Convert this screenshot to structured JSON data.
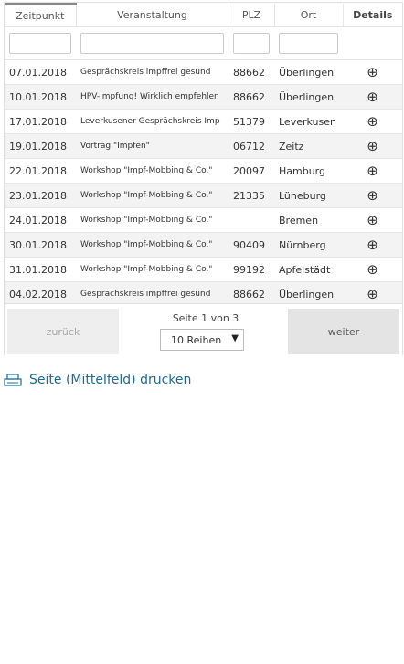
{
  "table": {
    "headers": [
      "Zeitpunkt",
      "Veranstaltung",
      "PLZ",
      "Ort",
      "Details"
    ],
    "rows": [
      {
        "date": "07.01.2018",
        "event": "Gesprächskreis impffrei gesund",
        "plz": "88662",
        "ort": "Überlingen"
      },
      {
        "date": "10.01.2018",
        "event": "HPV-Impfung! Wirklich empfehlen",
        "plz": "88662",
        "ort": "Überlingen"
      },
      {
        "date": "17.01.2018",
        "event": "Leverkusener Gesprächskreis Imp",
        "plz": "51379",
        "ort": "Leverkusen"
      },
      {
        "date": "19.01.2018",
        "event": "Vortrag \"Impfen\"",
        "plz": "06712",
        "ort": "Zeitz"
      },
      {
        "date": "22.01.2018",
        "event": "Workshop \"Impf-Mobbing & Co.\"",
        "plz": "20097",
        "ort": "Hamburg"
      },
      {
        "date": "23.01.2018",
        "event": "Workshop \"Impf-Mobbing & Co.\"",
        "plz": "21335",
        "ort": "Lüneburg"
      },
      {
        "date": "24.01.2018",
        "event": "Workshop \"Impf-Mobbing & Co.\"",
        "plz": "",
        "ort": "Bremen"
      },
      {
        "date": "30.01.2018",
        "event": "Workshop \"Impf-Mobbing & Co.\"",
        "plz": "90409",
        "ort": "Nürnberg"
      },
      {
        "date": "31.01.2018",
        "event": "Workshop \"Impf-Mobbing & Co.\"",
        "plz": "99192",
        "ort": "Apfelstädt"
      },
      {
        "date": "04.02.2018",
        "event": "Gesprächskreis impffrei gesund",
        "plz": "88662",
        "ort": "Überlingen"
      }
    ],
    "details_icon": "circled-plus-icon",
    "details_glyph": "⊕"
  },
  "pager": {
    "prev_label": "zurück",
    "next_label": "weiter",
    "page_info": "Seite 1 von 3",
    "rows_select": "10 Reihen",
    "rows_arrow": "▼"
  },
  "print": {
    "label": "Seite (Mittelfeld) drucken",
    "icon": "printer-icon"
  }
}
